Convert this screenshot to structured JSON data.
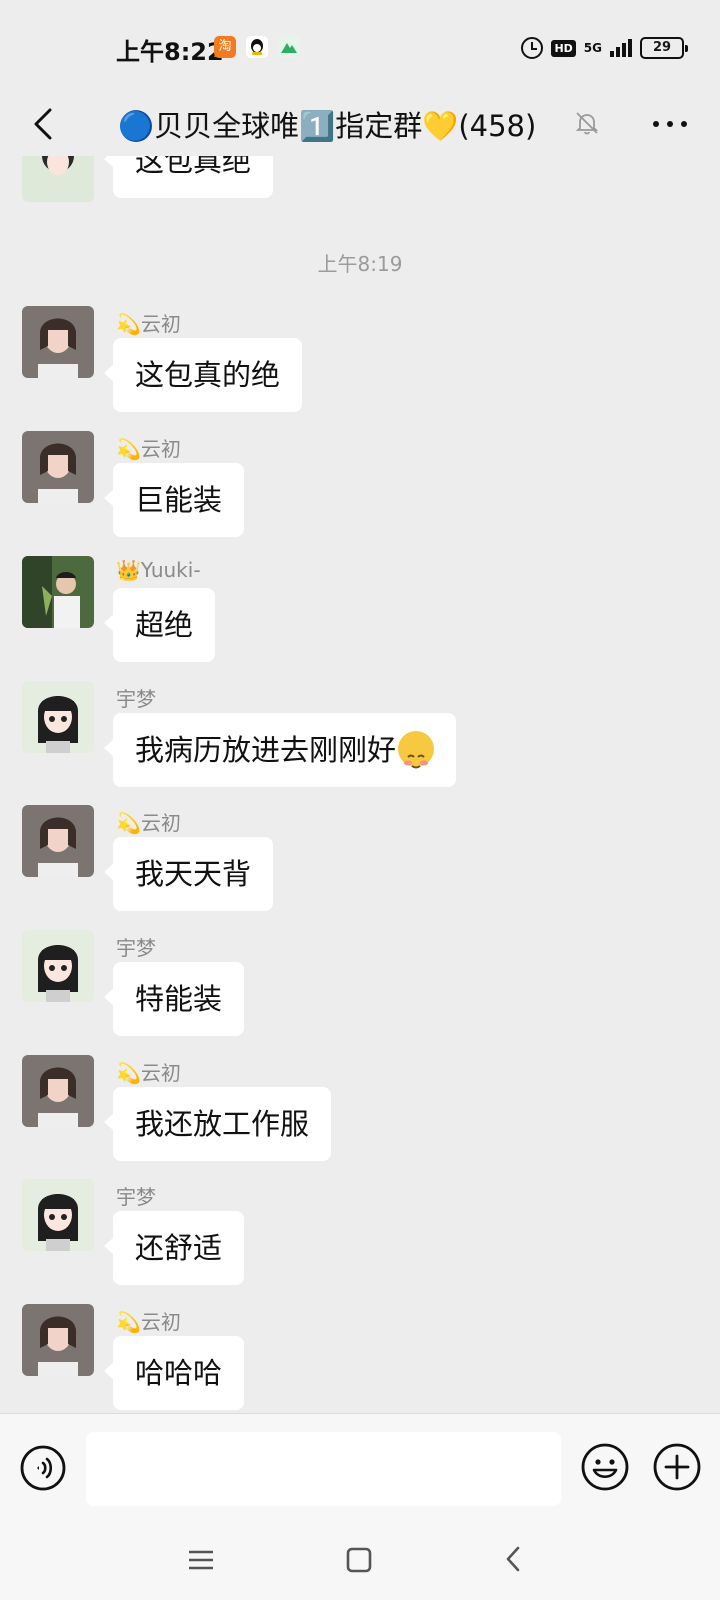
{
  "status_bar": {
    "time": "上午8:22",
    "network": "5G",
    "battery": "29"
  },
  "header": {
    "title": "🔵贝贝全球唯1️⃣指定群💛(458)"
  },
  "messages": [
    {
      "sender": "",
      "text": "这包真绝"
    },
    {
      "type": "timestamp",
      "text": "上午8:19"
    },
    {
      "sender": "💫云初",
      "text": "这包真的绝"
    },
    {
      "sender": "💫云初",
      "text": "巨能装"
    },
    {
      "sender": "👑Yuuki-",
      "text": "超绝"
    },
    {
      "sender": "宇梦",
      "text": "我病历放进去刚刚好",
      "emoji": "smiling-face-icon"
    },
    {
      "sender": "💫云初",
      "text": "我天天背"
    },
    {
      "sender": "宇梦",
      "text": "特能装"
    },
    {
      "sender": "💫云初",
      "text": "我还放工作服"
    },
    {
      "sender": "宇梦",
      "text": "还舒适"
    },
    {
      "sender": "💫云初",
      "text": "哈哈哈"
    }
  ],
  "input": {
    "value": "",
    "placeholder": ""
  },
  "colors": {
    "background": "#ededed",
    "bubble": "#ffffff",
    "sender_name": "#8a8a8a",
    "input_bar": "#f7f7f7"
  }
}
